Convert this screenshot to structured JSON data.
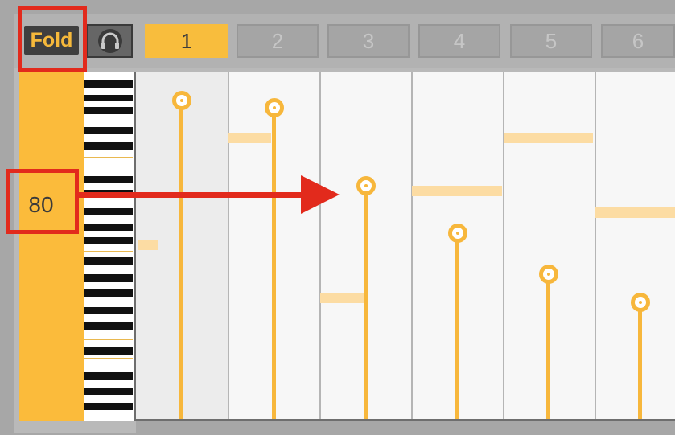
{
  "toolbar": {
    "fold_label": "Fold",
    "headphone_icon": "headphones-icon"
  },
  "step_tabs": [
    {
      "label": "1",
      "active": true
    },
    {
      "label": "2",
      "active": false
    },
    {
      "label": "3",
      "active": false
    },
    {
      "label": "4",
      "active": false
    },
    {
      "label": "5",
      "active": false
    },
    {
      "label": "6",
      "active": false
    }
  ],
  "velocity": {
    "value_label": "80"
  },
  "colors": {
    "accent": "#f8bd3d",
    "annotation": "#e22a1c",
    "note_bar": "#fcdca3"
  }
}
